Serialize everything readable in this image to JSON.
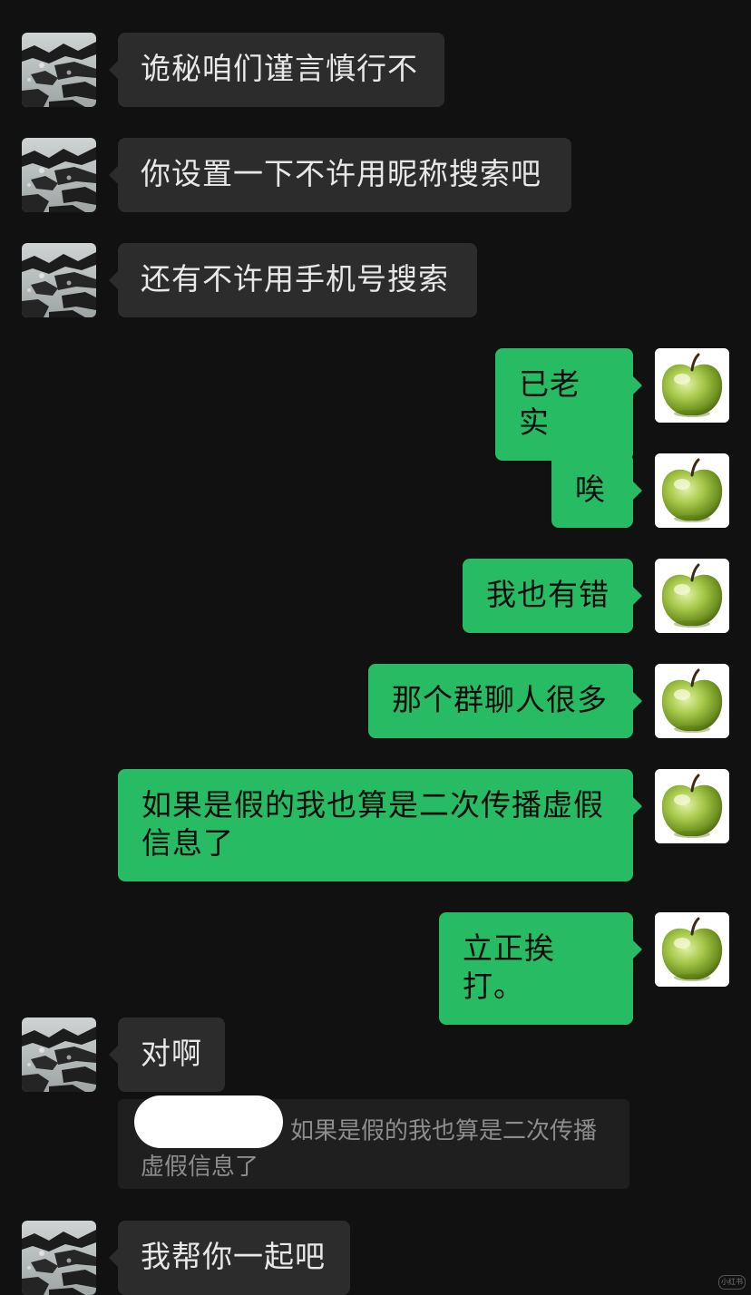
{
  "messages": {
    "m1": "诡秘咱们谨言慎行不",
    "m2": "你设置一下不许用昵称搜索吧",
    "m3": "还有不许用手机号搜索",
    "m4": "已老实",
    "m5": "唉",
    "m6": "我也有错",
    "m7": "那个群聊人很多",
    "m8": "如果是假的我也算是二次传播虚假信息了",
    "m9": "立正挨打。",
    "m10": "对啊",
    "m11": "我帮你一起吧"
  },
  "quote": {
    "text": "如果是假的我也算是二次传播虚假信息了"
  },
  "watermark": "小红书",
  "colors": {
    "background": "#111111",
    "incoming_bubble": "#2c2c2c",
    "outgoing_bubble": "#27bb63"
  },
  "icons": {
    "contact_avatar": "rocky-shore-photo",
    "self_avatar": "green-apple"
  }
}
